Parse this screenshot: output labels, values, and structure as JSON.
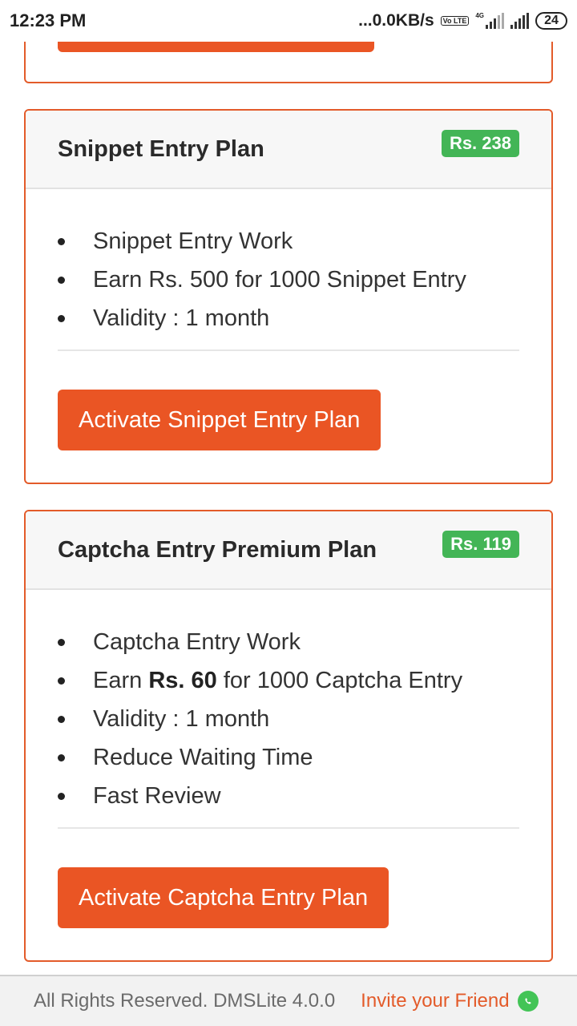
{
  "status_bar": {
    "time": "12:23 PM",
    "network_speed": "...0.0KB/s",
    "volte": "Vo LTE",
    "network_type": "4G",
    "battery": "24"
  },
  "plans": [
    {
      "title": "Snippet Entry Plan",
      "price": "Rs. 238",
      "features": [
        "Snippet Entry Work",
        "Earn Rs. 500 for 1000 Snippet Entry",
        "Validity : 1 month"
      ],
      "button_label": "Activate Snippet Entry Plan"
    },
    {
      "title": "Captcha Entry Premium Plan",
      "price": "Rs. 119",
      "features": [
        "Captcha Entry Work",
        {
          "prefix": "Earn ",
          "bold": "Rs. 60",
          "suffix": " for 1000 Captcha Entry"
        },
        "Validity : 1 month",
        "Reduce Waiting Time",
        "Fast Review"
      ],
      "button_label": "Activate Captcha Entry Plan"
    }
  ],
  "footer": {
    "copyright": "All Rights Reserved. DMSLite 4.0.0",
    "invite_link": "Invite your Friend",
    "invite_icon": "whatsapp-icon"
  },
  "colors": {
    "accent": "#ea5524",
    "badge": "#43b556",
    "whatsapp": "#43c456"
  }
}
